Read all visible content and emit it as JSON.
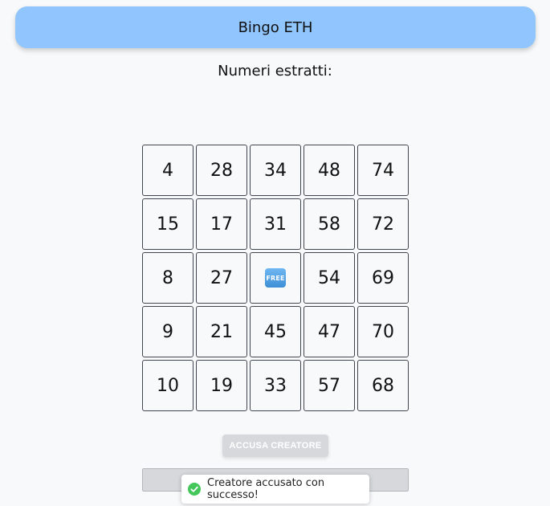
{
  "header": {
    "title": "Bingo ETH"
  },
  "drawn": {
    "title": "Numeri estratti:"
  },
  "card": {
    "cells": [
      "4",
      "28",
      "34",
      "48",
      "74",
      "15",
      "17",
      "31",
      "58",
      "72",
      "8",
      "27",
      "FREE",
      "54",
      "69",
      "9",
      "21",
      "45",
      "47",
      "70",
      "10",
      "19",
      "33",
      "57",
      "68"
    ],
    "free_icon": "free-button-icon"
  },
  "actions": {
    "accuse_label": "ACCUSA CREATORE"
  },
  "toast": {
    "icon": "check-circle-icon",
    "message": "Creatore accusato con successo!"
  },
  "colors": {
    "header_bg": "#90c5fd",
    "success": "#43c65a",
    "disabled": "#d6d8dc"
  }
}
